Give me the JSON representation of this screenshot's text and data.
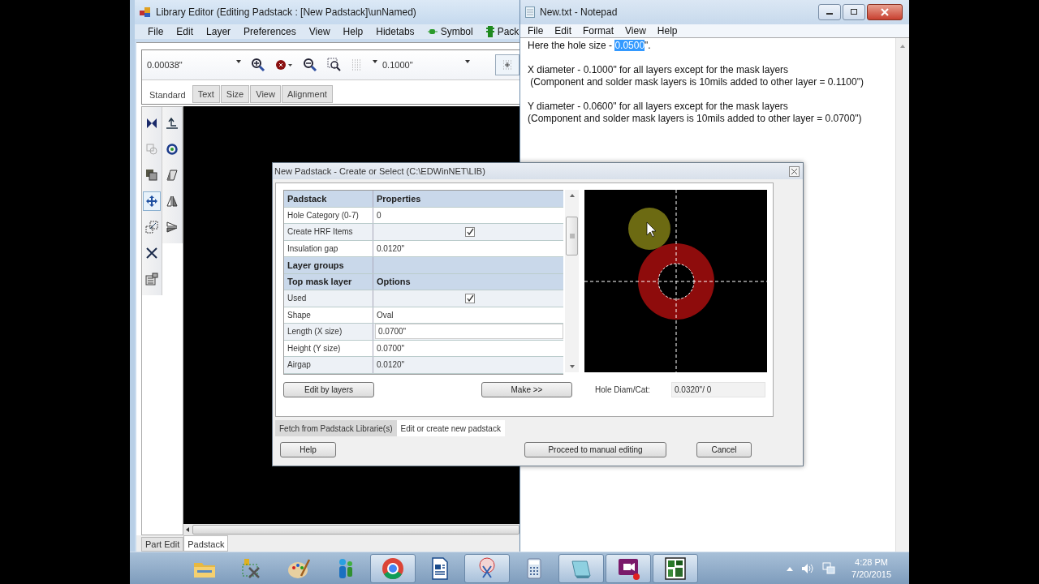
{
  "library_editor": {
    "title": "Library Editor (Editing Padstack : [New Padstack]\\unNamed)",
    "menu": [
      "File",
      "Edit",
      "Layer",
      "Preferences",
      "View",
      "Help",
      "Hidetabs"
    ],
    "menu_tools": [
      "Symbol",
      "Pack"
    ],
    "snap_value": "0.00038\"",
    "grid_value": "0.1000\"",
    "tabs": [
      {
        "label": "Standard",
        "selected": true
      },
      {
        "label": "Text",
        "selected": false
      },
      {
        "label": "Size",
        "selected": false
      },
      {
        "label": "View",
        "selected": false
      },
      {
        "label": "Alignment",
        "selected": false
      }
    ],
    "tool_columns": [
      [
        {
          "selected": false
        },
        {
          "selected": false
        },
        {
          "selected": false
        },
        {
          "selected": true
        },
        {
          "selected": false
        },
        {
          "selected": false
        },
        {
          "selected": false
        }
      ],
      [
        {
          "selected": false
        },
        {
          "selected": false
        },
        {
          "selected": false
        },
        {
          "selected": false
        },
        {
          "selected": false
        }
      ]
    ],
    "bottom_tabs": [
      {
        "label": "Part Edit",
        "selected": false
      },
      {
        "label": "Padstack",
        "selected": true
      }
    ]
  },
  "notepad": {
    "title": "New.txt - Notepad",
    "menu": [
      "File",
      "Edit",
      "Format",
      "View",
      "Help"
    ],
    "paragraphs": [
      [
        [
          {
            "text": "Here the hole size - ",
            "selected": false
          },
          {
            "text": "0.0500",
            "selected": true
          },
          {
            "text": "\".",
            "selected": false
          }
        ]
      ],
      [
        [
          {
            "text": "X diameter - 0.1000\" for all layers except for the mask layers",
            "selected": false
          }
        ],
        [
          {
            "text": " (Component and solder mask layers is 10mils added to other layer = 0.1100\")",
            "selected": false
          }
        ]
      ],
      [
        [
          {
            "text": "Y diameter - 0.0600\" for all layers except for the mask layers",
            "selected": false
          }
        ],
        [
          {
            "text": "(Component and solder mask layers is 10mils added to other layer = 0.0700\")",
            "selected": false
          }
        ]
      ]
    ]
  },
  "dialog": {
    "title": "New Padstack - Create or Select (C:\\EDWinNET\\LIB)",
    "rows": [
      {
        "kind": "header",
        "label": "Padstack",
        "value": "Properties"
      },
      {
        "kind": "text",
        "label": "Hole Category (0-7)",
        "value": "0"
      },
      {
        "kind": "check",
        "label": "Create HRF Items",
        "checked": true
      },
      {
        "kind": "text",
        "label": "Insulation gap",
        "value": "0.0120\""
      },
      {
        "kind": "header",
        "label": "Layer groups"
      },
      {
        "kind": "header",
        "label": "Top mask layer",
        "value": "Options"
      },
      {
        "kind": "check",
        "label": "Used",
        "checked": true
      },
      {
        "kind": "text",
        "label": "Shape",
        "value": "Oval"
      },
      {
        "kind": "edit",
        "label": "Length (X size)",
        "value": "0.0700\""
      },
      {
        "kind": "text",
        "label": "Height (Y size)",
        "value": "0.0700\""
      },
      {
        "kind": "text",
        "label": "Airgap",
        "value": "0.0120\""
      }
    ],
    "edit_button": "Edit by layers",
    "make_button": "Make >>",
    "hole_label": "Hole Diam/Cat:",
    "hole_value": "0.0320\"/ 0",
    "tabs": [
      {
        "label": "Fetch from Padstack Librarie(s)",
        "selected": false
      },
      {
        "label": "Edit or create new padstack",
        "selected": true
      }
    ],
    "help_button": "Help",
    "proceed_button": "Proceed to manual editing",
    "cancel_button": "Cancel"
  },
  "taskbar": {
    "apps": [
      {
        "running": false
      },
      {
        "running": false
      },
      {
        "running": false
      },
      {
        "running": false
      },
      {
        "running": true
      },
      {
        "running": false
      },
      {
        "running": true
      },
      {
        "running": false
      },
      {
        "running": true
      },
      {
        "running": true
      },
      {
        "running": true
      }
    ],
    "time": "4:28 PM",
    "date": "7/20/2015"
  }
}
